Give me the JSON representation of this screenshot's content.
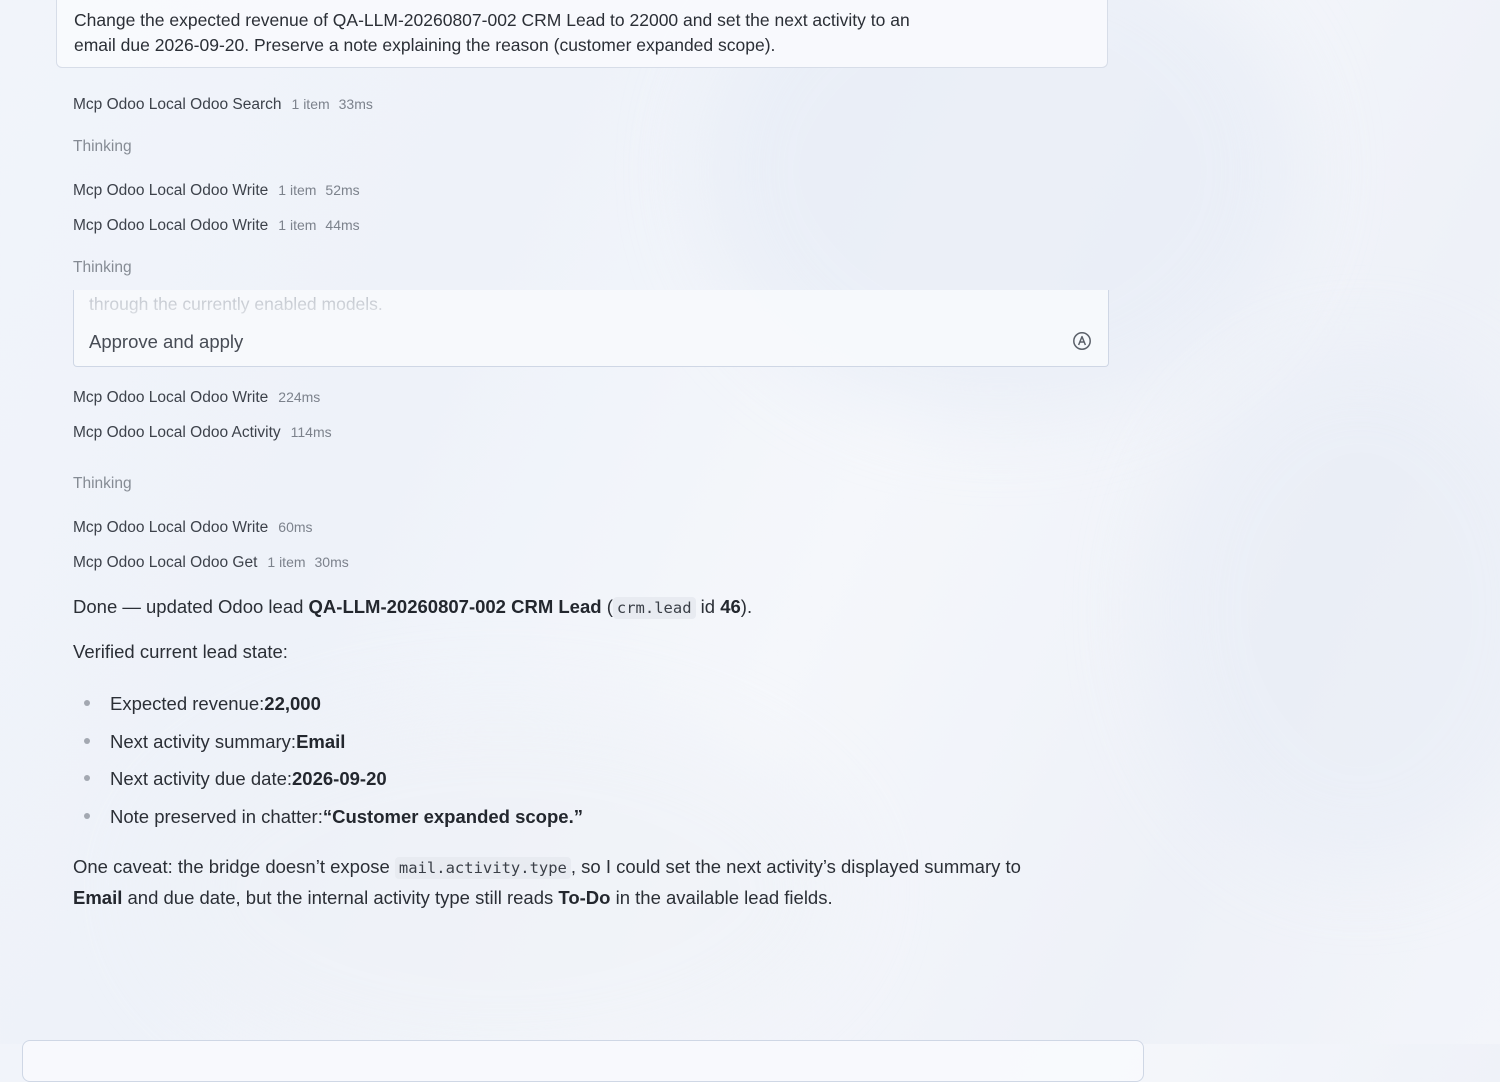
{
  "user_message": {
    "line1": "Change the expected revenue of QA-LLM-20260807-002 CRM Lead to 22000 and set the next activity to an",
    "line2": "email due 2026-09-20. Preserve a note explaining the reason (customer expanded scope)."
  },
  "steps": [
    {
      "name": "Mcp Odoo Local Odoo Search",
      "items": "1 item",
      "duration": "33ms"
    },
    {
      "name": "Thinking"
    },
    {
      "name": "Mcp Odoo Local Odoo Write",
      "items": "1 item",
      "duration": "52ms"
    },
    {
      "name": "Mcp Odoo Local Odoo Write",
      "items": "1 item",
      "duration": "44ms"
    },
    {
      "name": "Thinking"
    },
    {
      "name": "Mcp Odoo Local Odoo Write",
      "duration": "224ms"
    },
    {
      "name": "Mcp Odoo Local Odoo Activity",
      "duration": "114ms"
    },
    {
      "name": "Thinking"
    },
    {
      "name": "Mcp Odoo Local Odoo Write",
      "duration": "60ms"
    },
    {
      "name": "Mcp Odoo Local Odoo Get",
      "items": "1 item",
      "duration": "30ms"
    }
  ],
  "approval": {
    "faded_text": "through the currently enabled models.",
    "label": "Approve and apply",
    "icon": "auto-approve-circle-icon"
  },
  "answer": {
    "done_prefix": "Done — updated Odoo lead ",
    "lead_name": "QA-LLM-20260807-002 CRM Lead",
    "paren_open": " (",
    "model_code": "crm.lead",
    "id_word": " id ",
    "lead_id": "46",
    "paren_close": ").",
    "verified_heading": "Verified current lead state:",
    "bullets": [
      {
        "label": "Expected revenue: ",
        "value": "22,000"
      },
      {
        "label": "Next activity summary: ",
        "value": "Email"
      },
      {
        "label": "Next activity due date: ",
        "value": "2026-09-20"
      },
      {
        "label": "Note preserved in chatter: ",
        "value": "“Customer expanded scope.”"
      }
    ],
    "caveat": {
      "part1": "One caveat: the bridge doesn’t expose ",
      "code": "mail.activity.type",
      "part2": ", so I could set the next activity’s displayed summary to",
      "bold1": "Email",
      "part3": " and due date, but the internal activity type still reads ",
      "bold2": "To-Do",
      "part4": " in the available lead fields."
    }
  },
  "colors": {
    "text": "#2b2f36",
    "muted": "#7c828c",
    "border": "#d7dde8",
    "code_bg": "#e8ebf1"
  }
}
